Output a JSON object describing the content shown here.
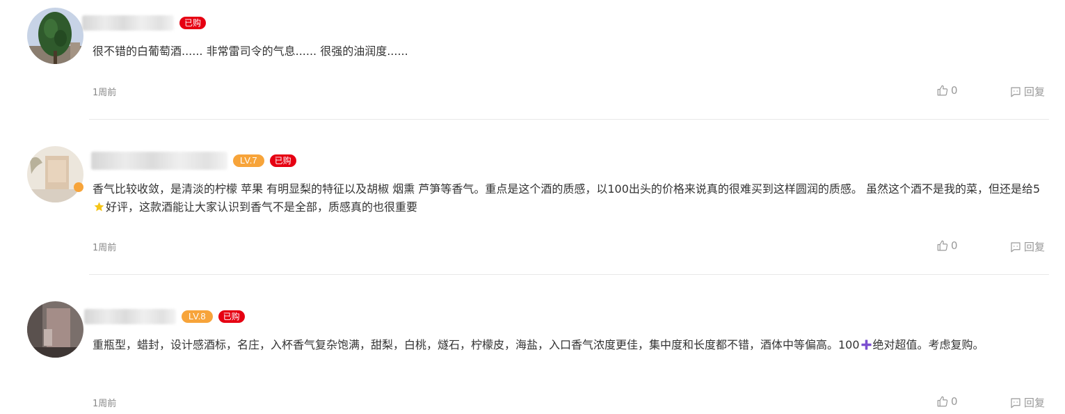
{
  "comments": [
    {
      "level": "",
      "bought": "已购",
      "text": "很不错的白葡萄酒...... 非常雷司令的气息...... 很强的油润度......",
      "time": "1周前",
      "likes": "0",
      "reply": "回复"
    },
    {
      "level": "LV.7",
      "bought": "已购",
      "text_before_icon": "香气比较收敛，是清淡的柠檬 苹果 有明显梨的特征以及胡椒 烟熏 芦笋等香气。重点是这个酒的质感，以100出头的价格来说真的很难买到这样圆润的质感。 虽然这个酒不是我的菜，但还是给5",
      "text_after_icon": "好评，这款酒能让大家认识到香气不是全部，质感真的也很重要",
      "inline_icon": "star-icon",
      "time": "1周前",
      "likes": "0",
      "reply": "回复"
    },
    {
      "level": "LV.8",
      "bought": "已购",
      "text_before_icon": "重瓶型，蜡封，设计感酒标，名庄，入杯香气复杂饱满，甜梨，白桃，燧石，柠檬皮，海盐，入口香气浓度更佳，集中度和长度都不错，酒体中等偏高。100",
      "text_after_icon": "绝对超值。考虑复购。",
      "inline_icon": "plus-icon",
      "time": "1周前",
      "likes": "0",
      "reply": "回复"
    }
  ],
  "colors": {
    "level_badge": "#f7a43a",
    "bought_badge": "#e60012",
    "muted_text": "#999999",
    "divider": "#e8e8e8",
    "plus_icon": "#7b4fd0",
    "star_icon": "#f5c518"
  }
}
